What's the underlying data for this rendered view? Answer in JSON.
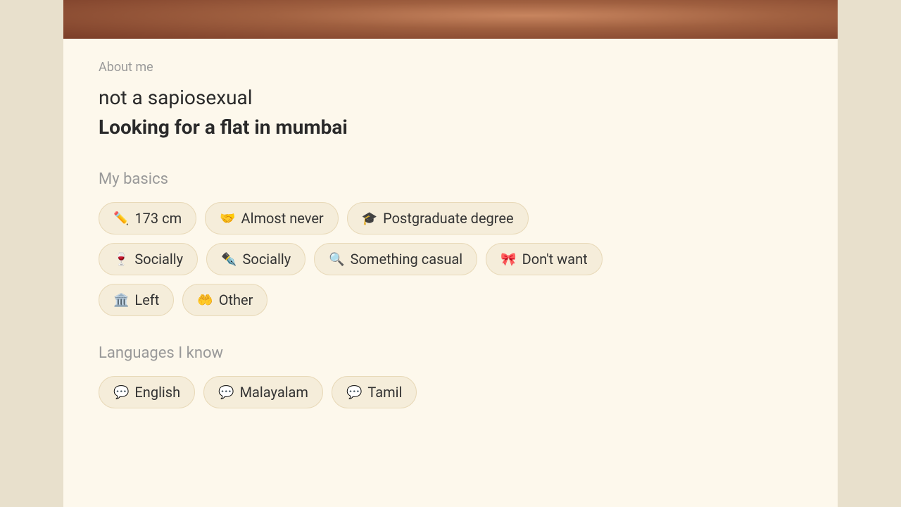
{
  "hero": {
    "alt": "Profile photo"
  },
  "about": {
    "section_label": "About me",
    "line1": "not a sapiosexual",
    "line2": "Looking for a flat in mumbai"
  },
  "basics": {
    "title": "My basics",
    "tags": [
      {
        "icon": "✏️",
        "label": "173 cm"
      },
      {
        "icon": "🤝",
        "label": "Almost never"
      },
      {
        "icon": "🎓",
        "label": "Postgraduate degree"
      },
      {
        "icon": "🍷",
        "label": "Socially"
      },
      {
        "icon": "✒️",
        "label": "Socially"
      },
      {
        "icon": "🔍",
        "label": "Something casual"
      },
      {
        "icon": "🎀",
        "label": "Don't want"
      },
      {
        "icon": "🏛️",
        "label": "Left"
      },
      {
        "icon": "🤲",
        "label": "Other"
      }
    ]
  },
  "languages": {
    "title": "Languages I know",
    "tags": [
      {
        "icon": "💬",
        "label": "English"
      },
      {
        "icon": "💬",
        "label": "Malayalam"
      },
      {
        "icon": "💬",
        "label": "Tamil"
      }
    ]
  }
}
